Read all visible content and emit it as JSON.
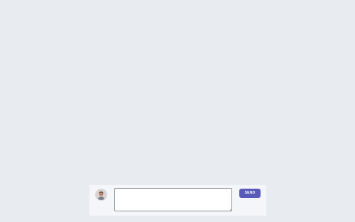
{
  "composer": {
    "avatar_icon": "user-avatar",
    "message_value": "",
    "message_placeholder": "",
    "send_label": "SEND",
    "send_color": "#5a5bb9"
  },
  "page": {
    "background_color": "#e8ebf0"
  }
}
